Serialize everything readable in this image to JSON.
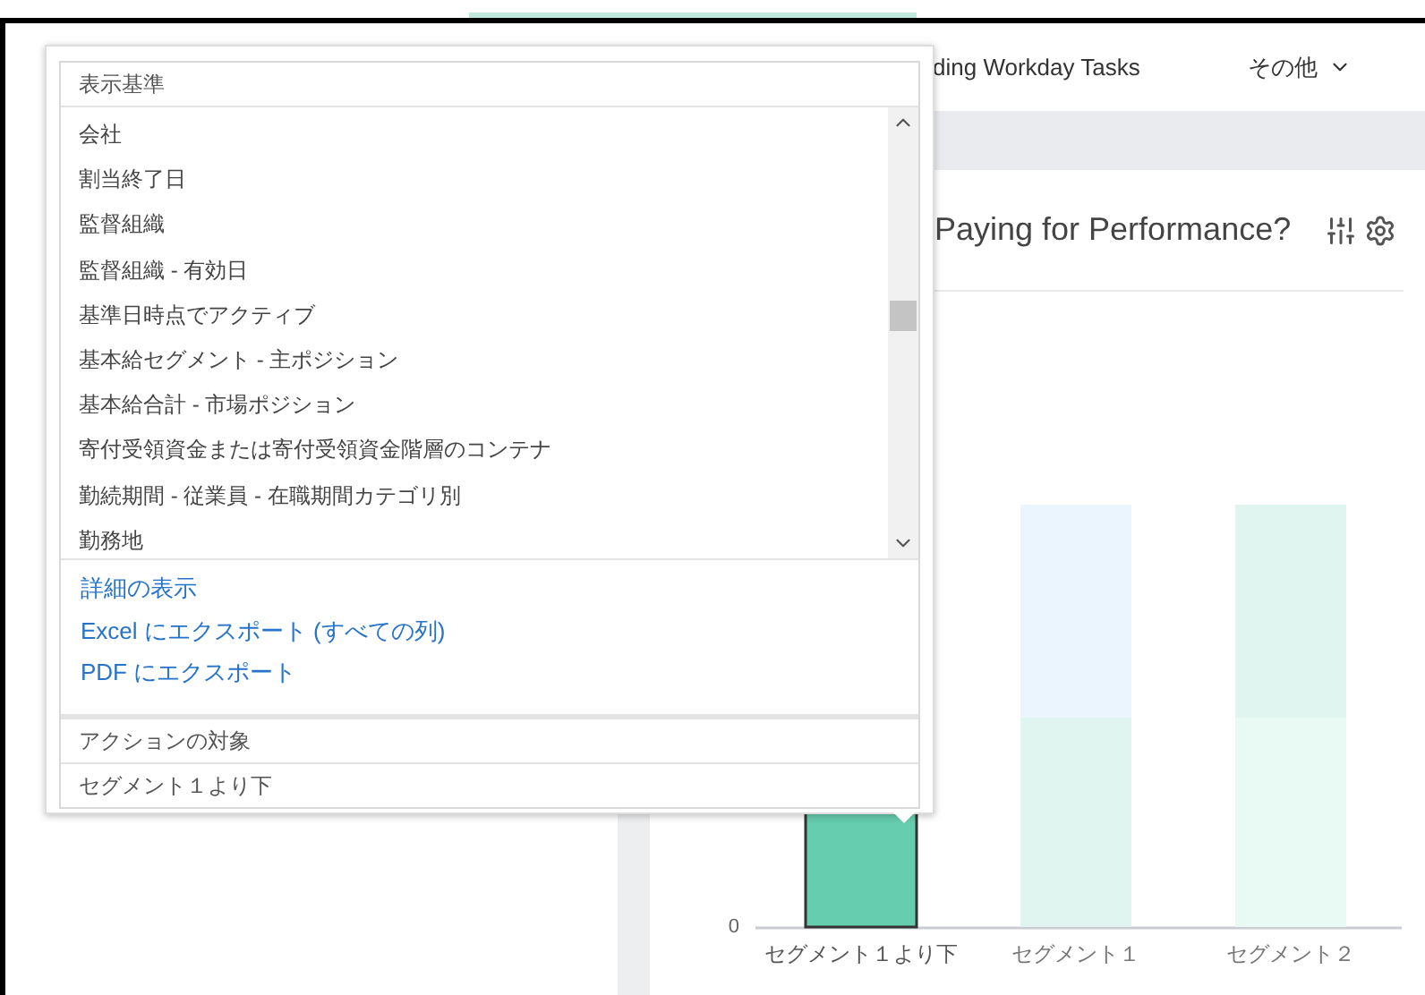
{
  "nav": {
    "tab": "ding Workday Tasks",
    "more_menu": "その他"
  },
  "card": {
    "title": "Paying for Performance?",
    "chart": {
      "y_tick": "0",
      "categories": [
        {
          "label": "セグメント１より下",
          "selected": true
        },
        {
          "label": "セグメント１",
          "selected": false
        },
        {
          "label": "セグメント２",
          "selected": false
        }
      ]
    }
  },
  "popup": {
    "header": "表示基準",
    "list_items": [
      "会社",
      "割当終了日",
      "監督組織",
      "監督組織 - 有効日",
      "基準日時点でアクティブ",
      "基本給セグメント - 主ポジション",
      "基本給合計 - 市場ポジション",
      "寄付受領資金または寄付受領資金階層のコンテナ",
      "勤続期間 - 従業員 - 在職期間カテゴリ別",
      "勤務地"
    ],
    "actions": [
      "詳細の表示",
      "Excel にエクスポート (すべての列)",
      "PDF にエクスポート"
    ],
    "target_label": "アクションの対象",
    "target_value": "セグメント１より下"
  }
}
